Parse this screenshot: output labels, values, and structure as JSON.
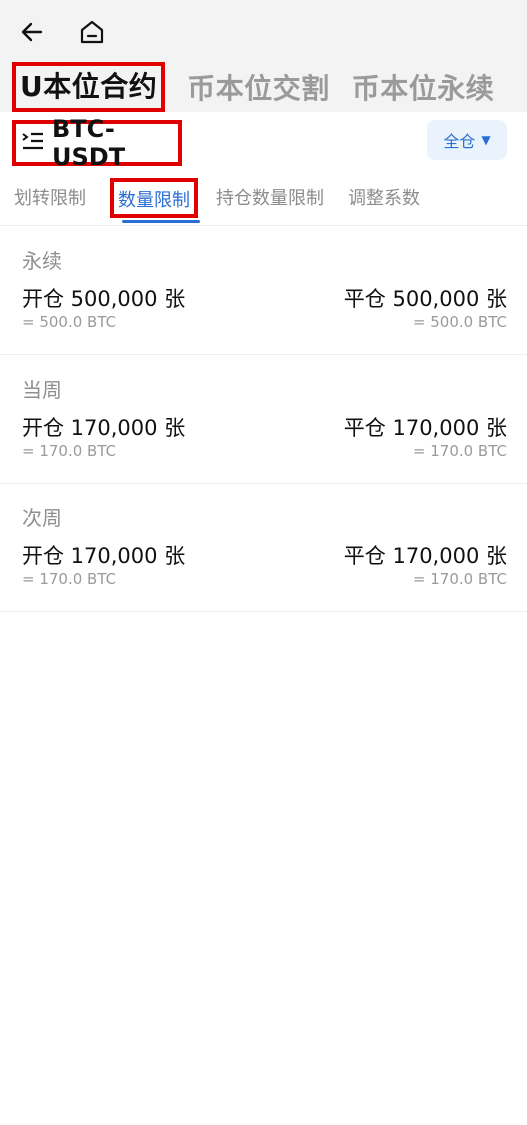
{
  "header": {
    "tabs": [
      {
        "label": "U本位合约"
      },
      {
        "label": "币本位交割"
      },
      {
        "label": "币本位永续"
      }
    ]
  },
  "pair": {
    "name": "BTC-USDT",
    "mode_label": "全仓"
  },
  "sub_tabs": [
    {
      "label": "划转限制"
    },
    {
      "label": "数量限制"
    },
    {
      "label": "持仓数量限制"
    },
    {
      "label": "调整系数"
    }
  ],
  "sections": [
    {
      "label": "永续",
      "open": "开仓 500,000 张",
      "close": "平仓 500,000 张",
      "open_btc": "= 500.0 BTC",
      "close_btc": "= 500.0 BTC"
    },
    {
      "label": "当周",
      "open": "开仓 170,000 张",
      "close": "平仓 170,000 张",
      "open_btc": "= 170.0 BTC",
      "close_btc": "= 170.0 BTC"
    },
    {
      "label": "次周",
      "open": "开仓 170,000 张",
      "close": "平仓 170,000 张",
      "open_btc": "= 170.0 BTC",
      "close_btc": "= 170.0 BTC"
    }
  ]
}
